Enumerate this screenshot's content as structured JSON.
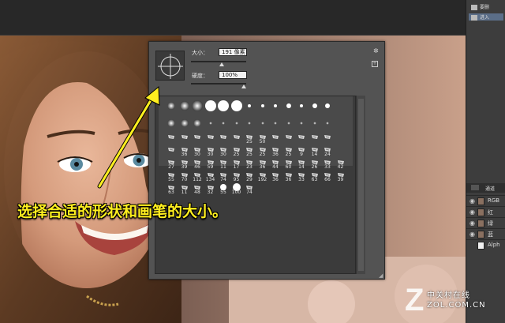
{
  "right_panel": {
    "history": [
      "要删",
      "进入"
    ],
    "tabs": [
      "",
      "通道"
    ],
    "channels": [
      {
        "name": "RGB"
      },
      {
        "name": "红"
      },
      {
        "name": "绿"
      },
      {
        "name": "蓝"
      },
      {
        "name": "Alph"
      }
    ]
  },
  "brush_panel": {
    "size_label": "大小：",
    "size_value": "191 像素",
    "hardness_label": "硬度：",
    "hardness_value": "100%",
    "size_slider_pct": 0.55,
    "hardness_slider_pct": 1.0,
    "gear_icon": "gear-icon",
    "tips": [
      {
        "row": 0,
        "label": ""
      },
      {
        "row": 0,
        "label": ""
      },
      {
        "row": 0,
        "label": ""
      },
      {
        "row": 0,
        "label": ""
      },
      {
        "row": 0,
        "label": ""
      },
      {
        "row": 0,
        "label": ""
      },
      {
        "row": 0,
        "label": ""
      },
      {
        "row": 0,
        "label": ""
      },
      {
        "row": 0,
        "label": ""
      },
      {
        "row": 0,
        "label": ""
      },
      {
        "row": 0,
        "label": ""
      },
      {
        "row": 0,
        "label": ""
      },
      {
        "row": 0,
        "label": ""
      },
      {
        "row": 1,
        "label": ""
      },
      {
        "row": 1,
        "label": ""
      },
      {
        "row": 1,
        "label": ""
      },
      {
        "row": 1,
        "label": ""
      },
      {
        "row": 1,
        "label": ""
      },
      {
        "row": 1,
        "label": ""
      },
      {
        "row": 1,
        "label": ""
      },
      {
        "row": 1,
        "label": ""
      },
      {
        "row": 1,
        "label": ""
      },
      {
        "row": 1,
        "label": ""
      },
      {
        "row": 1,
        "label": ""
      },
      {
        "row": 1,
        "label": ""
      },
      {
        "row": 1,
        "label": ""
      },
      {
        "row": 2,
        "label": ""
      },
      {
        "row": 2,
        "label": ""
      },
      {
        "row": 2,
        "label": ""
      },
      {
        "row": 2,
        "label": ""
      },
      {
        "row": 2,
        "label": ""
      },
      {
        "row": 2,
        "label": ""
      },
      {
        "row": 2,
        "label": "25"
      },
      {
        "row": 2,
        "label": "50"
      },
      {
        "row": 2,
        "label": ""
      },
      {
        "row": 2,
        "label": ""
      },
      {
        "row": 2,
        "label": ""
      },
      {
        "row": 2,
        "label": ""
      },
      {
        "row": 2,
        "label": ""
      },
      {
        "row": 3,
        "label": ""
      },
      {
        "row": 3,
        "label": "36"
      },
      {
        "row": 3,
        "label": "30"
      },
      {
        "row": 3,
        "label": "30"
      },
      {
        "row": 3,
        "label": "30"
      },
      {
        "row": 3,
        "label": "25"
      },
      {
        "row": 3,
        "label": "25"
      },
      {
        "row": 3,
        "label": "25"
      },
      {
        "row": 3,
        "label": "36"
      },
      {
        "row": 3,
        "label": "25"
      },
      {
        "row": 3,
        "label": "9"
      },
      {
        "row": 3,
        "label": "14"
      },
      {
        "row": 3,
        "label": "24"
      },
      {
        "row": 4,
        "label": "27"
      },
      {
        "row": 4,
        "label": "39"
      },
      {
        "row": 4,
        "label": "46"
      },
      {
        "row": 4,
        "label": "59"
      },
      {
        "row": 4,
        "label": "11"
      },
      {
        "row": 4,
        "label": "17"
      },
      {
        "row": 4,
        "label": "23"
      },
      {
        "row": 4,
        "label": "36"
      },
      {
        "row": 4,
        "label": "44"
      },
      {
        "row": 4,
        "label": "60"
      },
      {
        "row": 4,
        "label": "14"
      },
      {
        "row": 4,
        "label": "26"
      },
      {
        "row": 4,
        "label": "33"
      },
      {
        "row": 4,
        "label": "42"
      },
      {
        "row": 5,
        "label": "55"
      },
      {
        "row": 5,
        "label": "70"
      },
      {
        "row": 5,
        "label": "112"
      },
      {
        "row": 5,
        "label": "134"
      },
      {
        "row": 5,
        "label": "74"
      },
      {
        "row": 5,
        "label": "95"
      },
      {
        "row": 5,
        "label": "29"
      },
      {
        "row": 5,
        "label": "192"
      },
      {
        "row": 5,
        "label": "36"
      },
      {
        "row": 5,
        "label": "36"
      },
      {
        "row": 5,
        "label": "33"
      },
      {
        "row": 5,
        "label": "63"
      },
      {
        "row": 5,
        "label": "66"
      },
      {
        "row": 5,
        "label": "39"
      },
      {
        "row": 6,
        "label": "63"
      },
      {
        "row": 6,
        "label": "11"
      },
      {
        "row": 6,
        "label": "48"
      },
      {
        "row": 6,
        "label": "32"
      },
      {
        "row": 6,
        "label": "55"
      },
      {
        "row": 6,
        "label": "100"
      },
      {
        "row": 6,
        "label": "74"
      }
    ]
  },
  "caption": "选择合适的形状和画笔的大小。",
  "watermark": {
    "logo": "Z",
    "cn": "中关村在线",
    "en": "ZOL.COM.CN"
  },
  "colors": {
    "caption": "#ffef1f",
    "panel": "#535353",
    "arrow": "#ffef1f"
  }
}
